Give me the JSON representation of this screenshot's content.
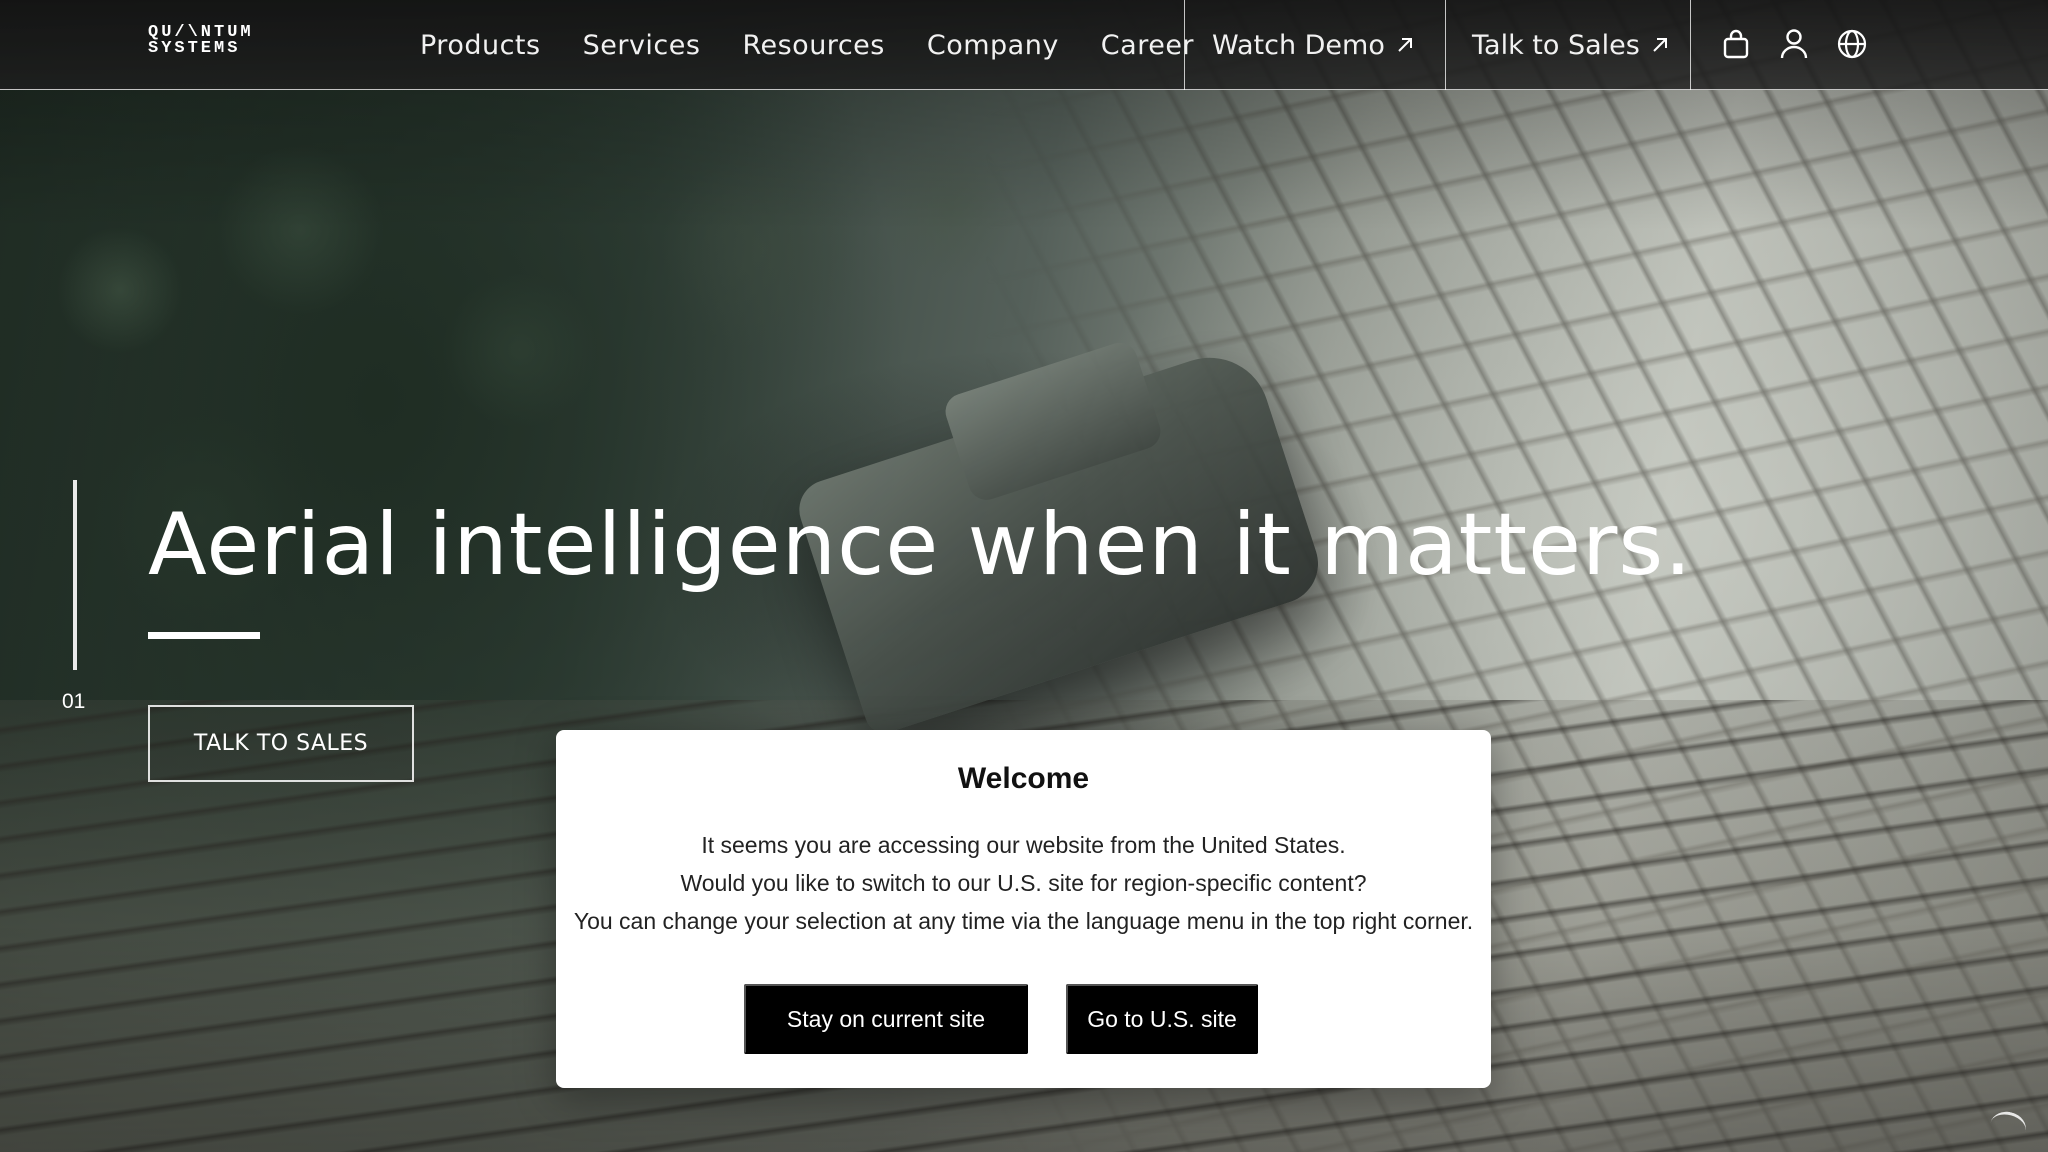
{
  "brand": {
    "logo_line1": "QU/\\NTUM",
    "logo_line2": "SYSTEMS",
    "logo_alt": "Quantum Systems"
  },
  "nav": {
    "items": [
      {
        "label": "Products"
      },
      {
        "label": "Services"
      },
      {
        "label": "Resources"
      },
      {
        "label": "Company"
      },
      {
        "label": "Career"
      }
    ],
    "watch_demo": "Watch Demo",
    "talk_to_sales": "Talk to Sales",
    "icons": [
      "shopping-bag-icon",
      "user-icon",
      "globe-icon"
    ]
  },
  "hero": {
    "title": "Aerial intelligence when it matters.",
    "cta": "TALK TO SALES",
    "slide_number": "01"
  },
  "modal": {
    "title": "Welcome",
    "lines": [
      "It seems you are accessing our website from the United States.",
      "Would you like to switch to our U.S. site for region-specific content?",
      "You can change your selection at any time via the language menu in the top right corner."
    ],
    "stay_button": "Stay on current site",
    "go_button": "Go to U.S. site"
  },
  "colors": {
    "nav_bg": "#1a1a1a",
    "modal_bg": "#ffffff",
    "button_bg": "#000000",
    "text_light": "#ffffff"
  }
}
